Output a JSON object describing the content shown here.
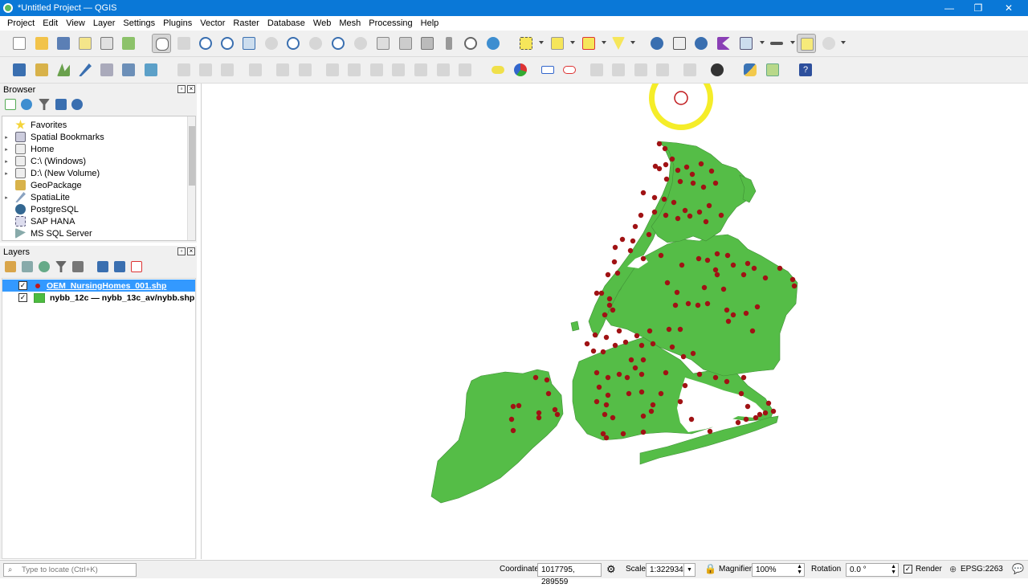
{
  "window": {
    "title": "*Untitled Project — QGIS",
    "minimize": "—",
    "maximize": "❐",
    "close": "✕"
  },
  "menu": [
    "Project",
    "Edit",
    "View",
    "Layer",
    "Settings",
    "Plugins",
    "Vector",
    "Raster",
    "Database",
    "Web",
    "Mesh",
    "Processing",
    "Help"
  ],
  "browser": {
    "title": "Browser",
    "items": [
      {
        "label": "Favorites",
        "icon": "star-icon"
      },
      {
        "label": "Spatial Bookmarks",
        "icon": "bookmark-icon"
      },
      {
        "label": "Home",
        "icon": "folder-icon"
      },
      {
        "label": "C:\\ (Windows)",
        "icon": "folder-icon"
      },
      {
        "label": "D:\\ (New Volume)",
        "icon": "folder-icon"
      },
      {
        "label": "GeoPackage",
        "icon": "geopackage-icon"
      },
      {
        "label": "SpatiaLite",
        "icon": "spatialite-icon"
      },
      {
        "label": "PostgreSQL",
        "icon": "postgresql-icon"
      },
      {
        "label": "SAP HANA",
        "icon": "sap-hana-icon"
      },
      {
        "label": "MS SQL Server",
        "icon": "mssql-icon"
      }
    ]
  },
  "layers": {
    "title": "Layers",
    "items": [
      {
        "label": "OEM_NursingHomes_001.shp",
        "checked": true,
        "selected": true,
        "symbol": "point",
        "color": "#c0181b"
      },
      {
        "label": "nybb_12c — nybb_13c_av/nybb.shp",
        "checked": true,
        "selected": false,
        "symbol": "polygon",
        "color": "#4cbc40"
      }
    ]
  },
  "map": {
    "fill_color": "#55bd47",
    "stroke_color": "#3f8f35",
    "point_color": "#a01214",
    "cursor_highlight": "#f4ec1e"
  },
  "status": {
    "locate_placeholder": "Type to locate (Ctrl+K)",
    "coordinate_label": "Coordinate",
    "coordinate_value": "1017795, 289559",
    "scale_label": "Scale",
    "scale_value": "1:322934",
    "magnifier_label": "Magnifier",
    "magnifier_value": "100%",
    "rotation_label": "Rotation",
    "rotation_value": "0.0 °",
    "render_label": "Render",
    "render_checked": true,
    "crs": "EPSG:2263"
  }
}
